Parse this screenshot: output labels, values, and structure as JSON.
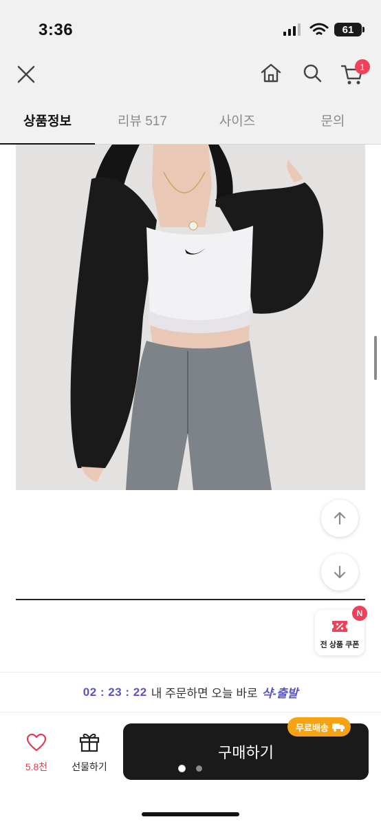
{
  "status_bar": {
    "time": "3:36",
    "battery": "61"
  },
  "nav": {
    "cart_count": "1"
  },
  "tabs": [
    {
      "label": "상품정보",
      "active": true
    },
    {
      "label": "리뷰 517",
      "active": false
    },
    {
      "label": "사이즈",
      "active": false
    },
    {
      "label": "문의",
      "active": false
    }
  ],
  "coupon": {
    "label": "전 상품 쿠폰",
    "badge": "N"
  },
  "promo": {
    "timer": "02 : 23 : 22",
    "text": "내 주문하면 오늘 바로",
    "brand": "샥-출발"
  },
  "bottom": {
    "like_count": "5.8천",
    "gift_label": "선물하기",
    "buy_label": "구매하기",
    "free_shipping_label": "무료배송"
  },
  "colors": {
    "accent_red": "#f0405a",
    "promo_purple": "#5a52c9",
    "shipping_orange": "#f6a313",
    "buy_button": "#1a1a1a"
  }
}
